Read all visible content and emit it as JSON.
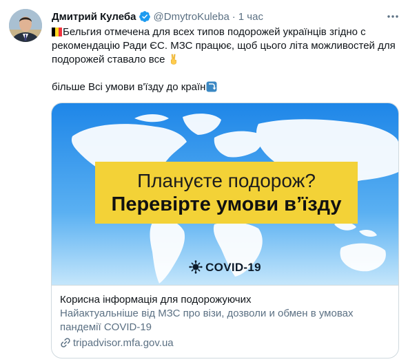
{
  "author": {
    "display_name": "Дмитрий Кулеба",
    "handle": "@DmytroKuleba",
    "separator": "·",
    "time": "1 час",
    "avatar_icon": "user-avatar"
  },
  "tweet": {
    "line1": "Бельгия отмечена для всех типов подорожей українців згідно с",
    "line2": "рекомендацію Ради ЄС. МЗС працює, щоб цього літа можливостей для",
    "line3": "подорожей ставало все",
    "line4": "більше Всі умови в'їзду до країн"
  },
  "card": {
    "image": {
      "headline1": "Плануєте подорож?",
      "headline2": "Перевірте умови в’їзду",
      "covid_label": "COVID-19"
    },
    "title": "Корисна інформація для подорожуючих",
    "description": "Найактуальніше від МЗС про візи, дозволи и обмен в умовах пандемії COVID-19",
    "domain": "tripadvisor.mfa.gov.ua"
  },
  "colors": {
    "accent": "#1d9bf0",
    "banner": "#f3d237",
    "sky_top": "#1e86e8",
    "sky_bottom": "#bfe3fb"
  }
}
